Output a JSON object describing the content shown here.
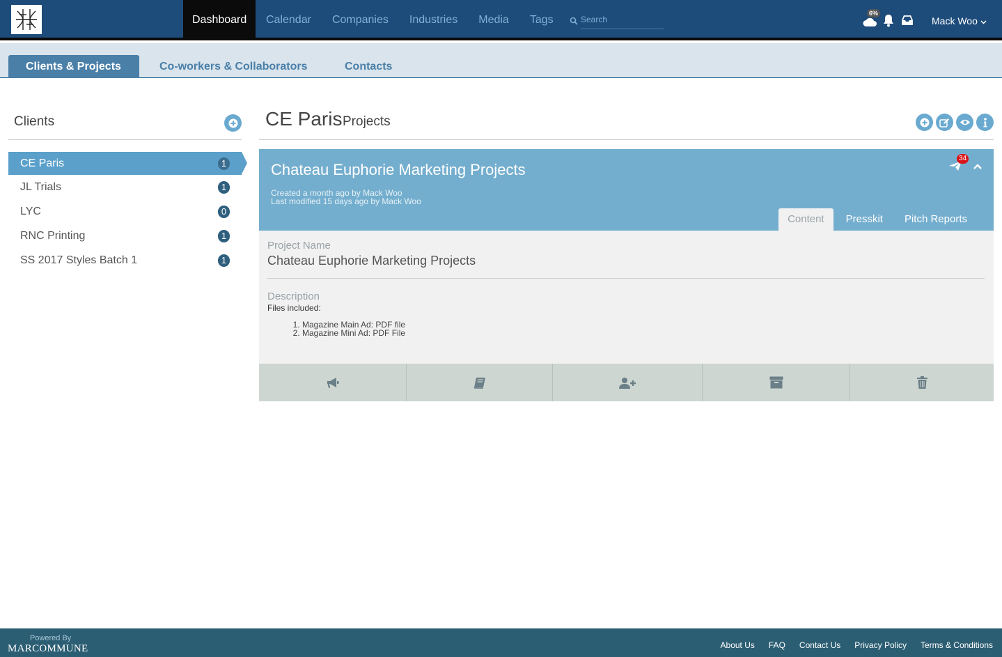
{
  "nav": {
    "items": [
      {
        "label": "Dashboard",
        "active": true
      },
      {
        "label": "Calendar"
      },
      {
        "label": "Companies"
      },
      {
        "label": "Industries"
      },
      {
        "label": "Media"
      },
      {
        "label": "Tags"
      }
    ],
    "search_placeholder": "Search",
    "storage_percent": "6%",
    "user_name": "Mack Woo"
  },
  "tabs": [
    {
      "label": "Clients & Projects",
      "active": true
    },
    {
      "label": "Co-workers & Collaborators"
    },
    {
      "label": "Contacts"
    }
  ],
  "sidebar": {
    "title": "Clients",
    "clients": [
      {
        "name": "CE Paris",
        "count": "1",
        "active": true
      },
      {
        "name": "JL Trials",
        "count": "1"
      },
      {
        "name": "LYC",
        "count": "0"
      },
      {
        "name": "RNC Printing",
        "count": "1"
      },
      {
        "name": "SS 2017 Styles Batch 1",
        "count": "1"
      }
    ]
  },
  "main": {
    "title": "CE Paris",
    "subtitle": "Projects"
  },
  "project": {
    "title": "Chateau Euphorie Marketing Projects",
    "created": "Created a month ago by Mack Woo",
    "modified": "Last modified 15 days ago by Mack Woo",
    "notification_count": "34",
    "tabs": [
      {
        "label": "Content",
        "active": true
      },
      {
        "label": "Presskit"
      },
      {
        "label": "Pitch Reports"
      }
    ],
    "name_label": "Project Name",
    "name_value": "Chateau Euphorie Marketing Projects",
    "description_label": "Description",
    "description_intro": "Files included:",
    "files": [
      "Magazine Main Ad: PDF file",
      "Magazine Mini Ad: PDF File"
    ]
  },
  "footer": {
    "powered_by": "Powered By",
    "brand": "MARCOMMUNE",
    "links": [
      "About Us",
      "FAQ",
      "Contact Us",
      "Privacy Policy",
      "Terms & Conditions"
    ]
  },
  "colors": {
    "nav_bg": "#1e4c7a",
    "accent": "#5ba0cb",
    "footer_bg": "#2c5e73",
    "badge_red": "#d9151b"
  }
}
